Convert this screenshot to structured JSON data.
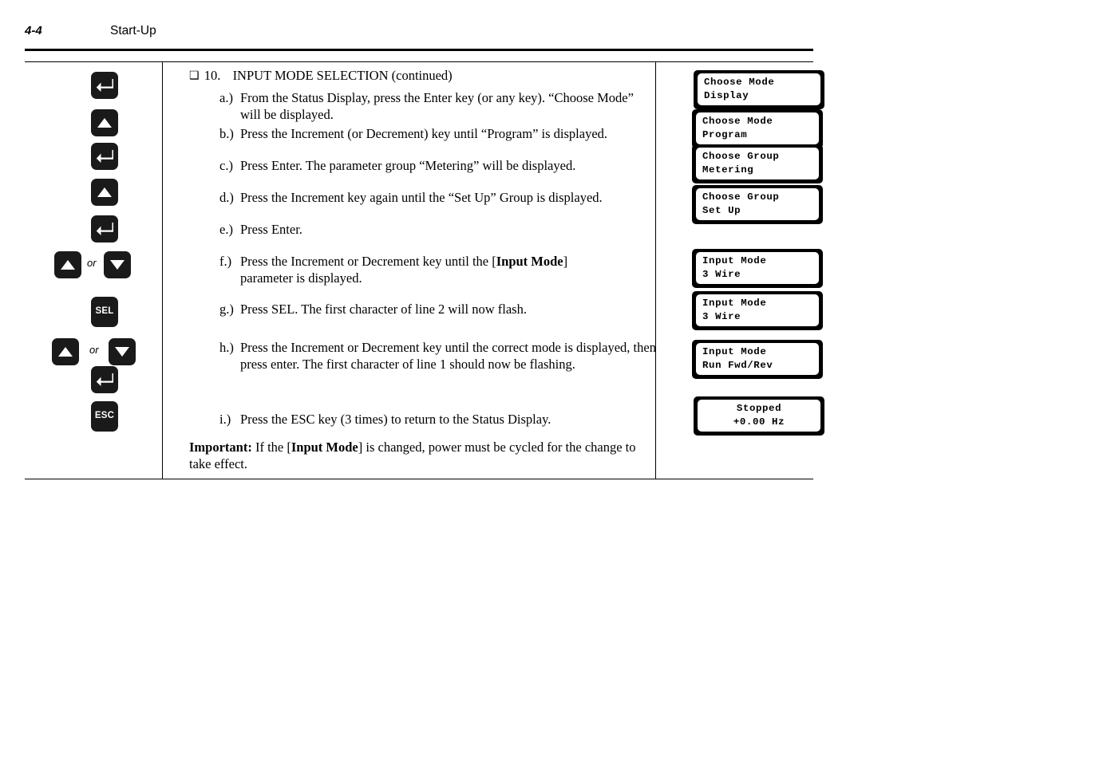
{
  "header": {
    "folio": "4-4",
    "chapter": "Start-Up"
  },
  "section": {
    "checkbox_glyph": "❑",
    "number": "10.",
    "title": "INPUT MODE SELECTION (continued)"
  },
  "steps": [
    {
      "mark": "a.)",
      "text": "From the Status Display, press the Enter key (or any key).  “Choose Mode” will be displayed."
    },
    {
      "mark": "b.)",
      "text": "Press the Increment (or Decrement) key until “Program” is displayed."
    },
    {
      "mark": "c.)",
      "text": "Press Enter.  The parameter group “Metering” will be displayed."
    },
    {
      "mark": "d.)",
      "text": "Press the Increment key again until the “Set Up” Group is displayed."
    },
    {
      "mark": "e.)",
      "text": "Press Enter."
    },
    {
      "mark": "f.)",
      "text_pre": "Press the Increment or Decrement key until the [",
      "text_bold": "Input Mode",
      "text_post": "] parameter is displayed."
    },
    {
      "mark": "g.)",
      "text": "Press SEL.  The first character of line 2 will now flash."
    },
    {
      "mark": "h.)",
      "text": "Press the Increment or Decrement key until the correct mode is displayed, then press enter.  The first character of line 1 should now be flashing."
    },
    {
      "mark": "i.)",
      "text": "Press the ESC key (3 times) to return to the Status Display."
    }
  ],
  "important": {
    "label": "Important:",
    "text_pre": " If the [",
    "text_bold": "Input Mode",
    "text_post": "] is changed, power must be cycled for the change to take effect."
  },
  "keys": [
    {
      "icon": "enter-key-icon",
      "label": "",
      "type": "glyph"
    },
    {
      "icon": "increment-key-icon",
      "label": "",
      "type": "glyph"
    },
    {
      "icon": "enter-key-icon",
      "label": "",
      "type": "glyph"
    },
    {
      "icon": "increment-key-icon",
      "label": "",
      "type": "glyph"
    },
    {
      "icon": "enter-key-icon",
      "label": "",
      "type": "glyph"
    },
    {
      "icon": "increment-key-icon",
      "label": "",
      "type": "glyph"
    },
    {
      "icon": "decrement-key-icon",
      "label": "",
      "type": "glyph"
    },
    {
      "icon": "sel-key-icon",
      "label": "SEL",
      "type": "text"
    },
    {
      "icon": "increment-key-icon",
      "label": "",
      "type": "glyph"
    },
    {
      "icon": "decrement-key-icon",
      "label": "",
      "type": "glyph"
    },
    {
      "icon": "enter-key-icon",
      "label": "",
      "type": "glyph"
    },
    {
      "icon": "esc-key-icon",
      "label": "ESC",
      "type": "text"
    }
  ],
  "or_label": "or",
  "displays": [
    {
      "line1": "Choose Mode",
      "line2": "Display",
      "align": "left"
    },
    {
      "line1": "Choose Mode",
      "line2": "Program",
      "align": "left"
    },
    {
      "line1": "Choose Group",
      "line2": "Metering",
      "align": "left"
    },
    {
      "line1": "Choose Group",
      "line2": "Set Up",
      "align": "left"
    },
    {
      "line1": "Input Mode",
      "line2": "3 Wire",
      "align": "left"
    },
    {
      "line1": "Input Mode",
      "line2": "3 Wire",
      "align": "left"
    },
    {
      "line1": "Input Mode",
      "line2": "Run Fwd/Rev",
      "align": "left"
    },
    {
      "line1": "Stopped",
      "line2": "+0.00 Hz",
      "align": "center"
    }
  ],
  "colors": {
    "ink": "#000000",
    "key_body": "#1a1a1a",
    "key_glyph": "#ffffff",
    "lcd_bezel": "#000000",
    "lcd_screen": "#ffffff",
    "page": "#ffffff"
  }
}
